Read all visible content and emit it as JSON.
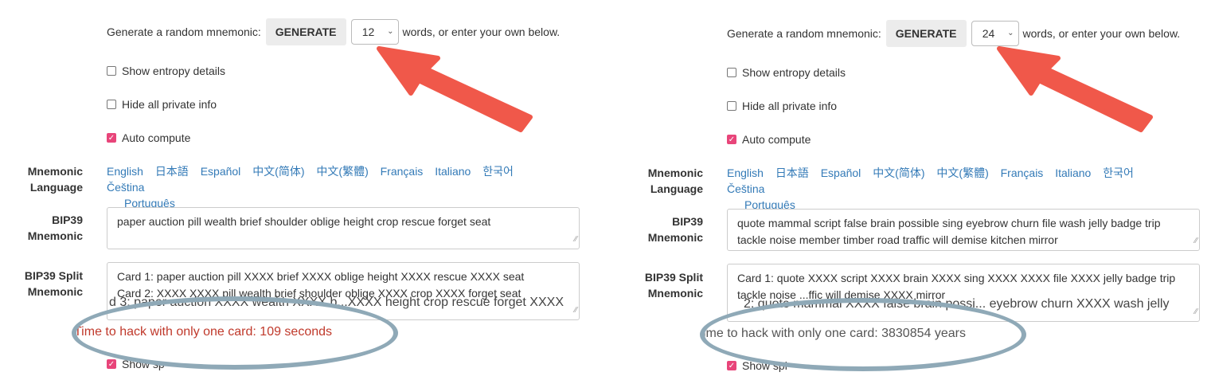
{
  "common": {
    "generate_prefix": "Generate a random mnemonic:",
    "generate_button": "GENERATE",
    "generate_suffix": "words, or enter your own below.",
    "show_entropy": "Show entropy details",
    "hide_private": "Hide all private info",
    "auto_compute": "Auto compute",
    "mnemonic_language_label_1": "Mnemonic",
    "mnemonic_language_label_2": "Language",
    "bip39_label_1": "BIP39",
    "bip39_label_2": "Mnemonic",
    "split_label_1": "BIP39 Split",
    "split_label_2": "Mnemonic",
    "languages": [
      "English",
      "日本語",
      "Español",
      "中文(简体)",
      "中文(繁體)",
      "Français",
      "Italiano",
      "한국어",
      "Čeština",
      "Português"
    ],
    "show_split_partial": "Show sp"
  },
  "left": {
    "word_count": "12",
    "mnemonic": "paper auction pill wealth brief shoulder oblige height crop rescue forget seat",
    "card1": "Card 1: paper auction pill XXXX brief XXXX oblige height XXXX rescue XXXX seat",
    "card2": "Card 2: XXXX XXXX pill wealth brief shoulder oblige XXXX crop XXXX forget seat",
    "card3": "d 3: paper auction XXXX wealth XXXX b...XXXX height crop rescue forget XXXX",
    "hack_text": "Time to hack with only one card: 109 seconds",
    "hack_color": "#c0392b"
  },
  "right": {
    "word_count": "24",
    "mnemonic_line1": "quote mammal script false brain possible sing eyebrow churn file wash jelly badge trip",
    "mnemonic_line2": "tackle noise member timber road traffic will demise kitchen mirror",
    "card1": "Card 1: quote XXXX script XXXX brain XXXX sing XXXX XXXX file XXXX jelly badge trip",
    "card1b": "tackle noise ...ffic will demise XXXX mirror",
    "card2": "2: quote mammal XXXX false brain possi... eyebrow churn XXXX wash jelly",
    "hack_text": "ime to hack with only one card: 3830854 years",
    "hack_color": "#555555",
    "show_split_partial": "Show spl"
  },
  "colors": {
    "arrow": "#f0584a",
    "ellipse": "#8fa9b7",
    "checkbox": "#e8457a",
    "link": "#337ab7"
  }
}
